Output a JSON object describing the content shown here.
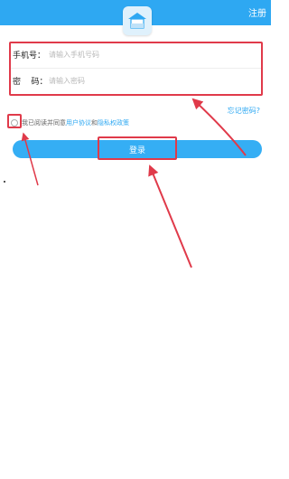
{
  "header": {
    "register_label": "注册",
    "logo_icon": "house-logo-icon"
  },
  "form": {
    "phone_label": "手机号：",
    "phone_placeholder": "请输入手机号码",
    "password_label": "密    码：",
    "password_placeholder": "请输入密码"
  },
  "forgot_password": "忘记密码?",
  "agreement": {
    "prefix": "我已阅读并同意",
    "user_agreement": "用户协议",
    "conjunction": "和",
    "privacy_policy": "隐私权政策"
  },
  "login_button": "登录",
  "colors": {
    "accent": "#2ea8f2",
    "annotation_red": "#e03a4a"
  }
}
